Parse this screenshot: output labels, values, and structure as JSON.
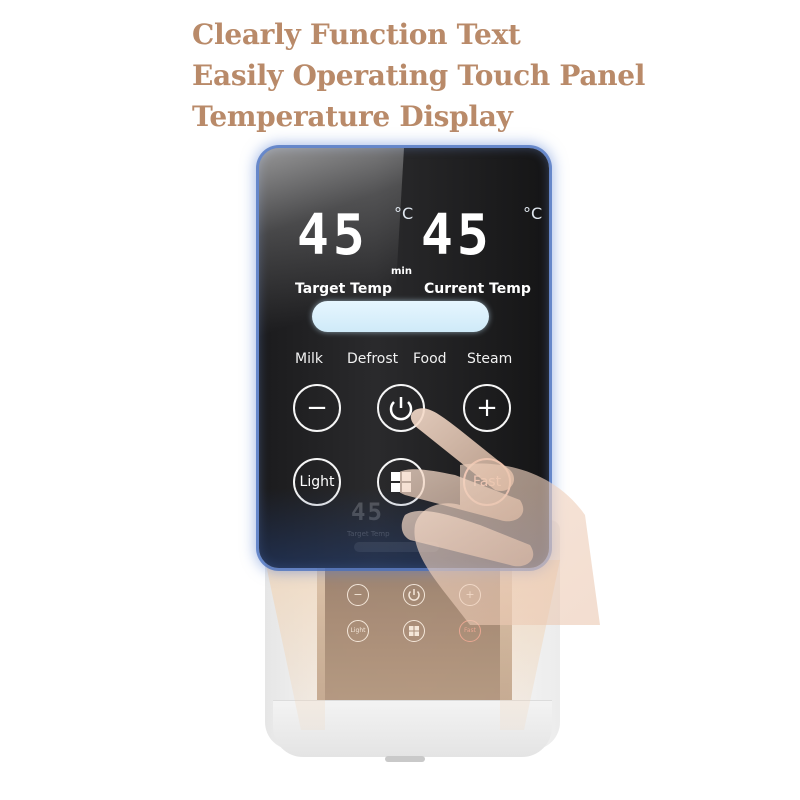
{
  "headline": {
    "lines": [
      "Clearly Function Text",
      "Easily Operating Touch Panel",
      "Temperature Display"
    ],
    "color": "#b98a69"
  },
  "display": {
    "target_temp_value": "45",
    "current_temp_value": "45",
    "unit": "°C",
    "min_label": "min",
    "target_temp_label": "Target Temp",
    "current_temp_label": "Current Temp",
    "progress_fraction": 1.0
  },
  "modes": [
    "Milk",
    "Defrost",
    "Food",
    "Steam"
  ],
  "buttons": {
    "minus": "−",
    "power": "power-icon",
    "plus": "+",
    "light": "Light",
    "menu": "grid-icon",
    "fast": "Fast"
  },
  "ghost_display": {
    "digits": "45",
    "label": "Target Temp"
  },
  "device_buttons": {
    "minus": "−",
    "plus": "+",
    "light": "Light",
    "fast": "Fast"
  },
  "colors": {
    "panel_glow": "#466ebe",
    "fast_accent": "#e7a795",
    "progress_fill": "#dff3fd"
  }
}
